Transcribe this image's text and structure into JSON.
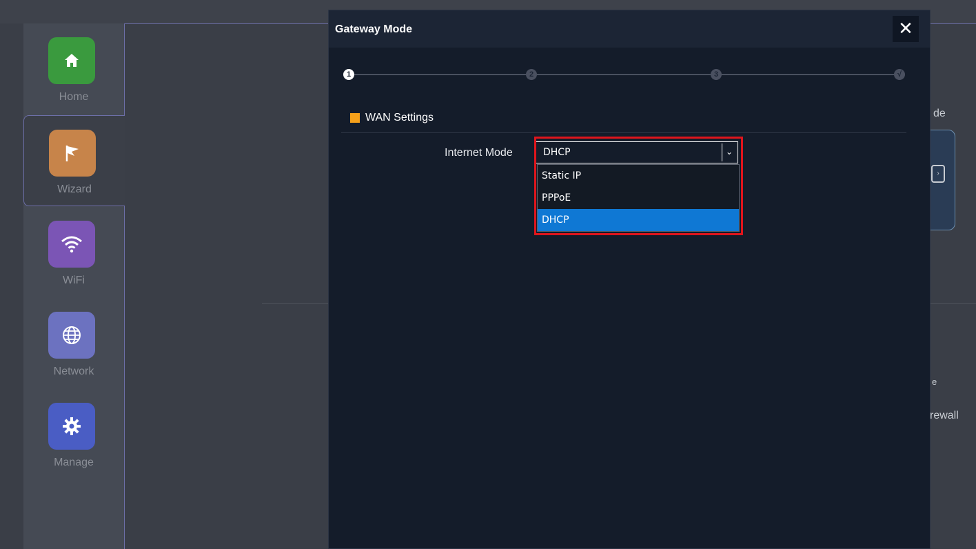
{
  "sidebar": {
    "items": [
      {
        "label": "Home",
        "icon": "home-icon",
        "color": "#3a9a3e"
      },
      {
        "label": "Wizard",
        "icon": "flag-icon",
        "color": "#c7844a"
      },
      {
        "label": "WiFi",
        "icon": "wifi-icon",
        "color": "#7b55b5"
      },
      {
        "label": "Network",
        "icon": "globe-icon",
        "color": "#6c72c0"
      },
      {
        "label": "Manage",
        "icon": "gear-icon",
        "color": "#4a5dc4"
      }
    ],
    "active_item": "Wizard"
  },
  "background": {
    "right_text_1": "de",
    "right_text_2": "e",
    "right_text_3": "rewall"
  },
  "modal": {
    "title": "Gateway Mode",
    "close_label": "✕",
    "steps": [
      "1",
      "2",
      "3",
      "√"
    ],
    "current_step": 1,
    "section_title": "WAN Settings",
    "accent_color": "#f5a01a",
    "internet_mode": {
      "label": "Internet Mode",
      "selected": "DHCP",
      "options": [
        "Static IP",
        "PPPoE",
        "DHCP"
      ],
      "highlight_color": "#e0151c"
    }
  }
}
